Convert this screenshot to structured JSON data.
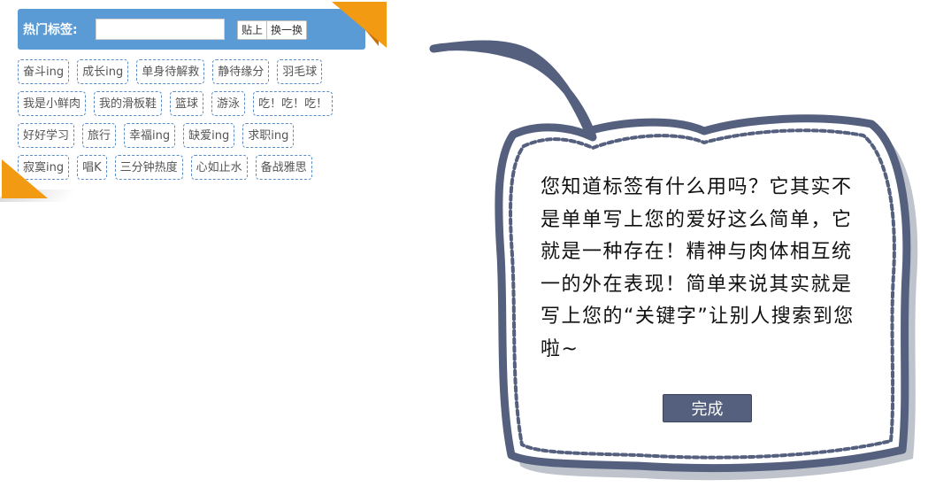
{
  "hot_tags": {
    "header_label": "热门标签:",
    "input_value": "",
    "input_placeholder": "",
    "paste_button": "贴上",
    "refresh_button": "换一换",
    "rows": [
      [
        "奋斗ing",
        "成长ing",
        "单身待解救",
        "静待缘分",
        "羽毛球"
      ],
      [
        "我是小鲜肉",
        "我的滑板鞋",
        "篮球",
        "游泳",
        "吃！吃！吃！"
      ],
      [
        "好好学习",
        "旅行",
        "幸福ing",
        "缺爱ing",
        "求职ing"
      ],
      [
        "寂寞ing",
        "唱K",
        "三分钟热度",
        "心如止水",
        "备战雅思"
      ]
    ]
  },
  "bubble": {
    "message": "您知道标签有什么用吗？它其实不是单单写上您的爱好这么简单，它就是一种存在！精神与肉体相互统一的外在表现！简单来说其实就是写上您的“关键字”让别人搜索到您啦~",
    "done_button": "完成"
  },
  "colors": {
    "header_bg": "#5b9bd5",
    "fold_orange": "#f39a13",
    "bubble_border": "#55607f",
    "done_button_bg": "#55607f"
  }
}
